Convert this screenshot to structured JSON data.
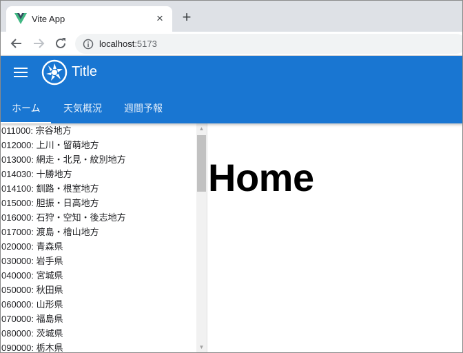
{
  "browser": {
    "tab_title": "Vite App",
    "tab_close": "×",
    "new_tab": "+",
    "url_host": "localhost",
    "url_port": ":5173"
  },
  "app": {
    "title": "Title",
    "accent_color": "#1976d2",
    "tabs": [
      {
        "label": "ホーム",
        "active": true
      },
      {
        "label": "天気概況",
        "active": false
      },
      {
        "label": "週間予報",
        "active": false
      }
    ]
  },
  "area_list": [
    "011000: 宗谷地方",
    "012000: 上川・留萌地方",
    "013000: 網走・北見・紋別地方",
    "014030: 十勝地方",
    "014100: 釧路・根室地方",
    "015000: 胆振・日高地方",
    "016000: 石狩・空知・後志地方",
    "017000: 渡島・檜山地方",
    "020000: 青森県",
    "030000: 岩手県",
    "040000: 宮城県",
    "050000: 秋田県",
    "060000: 山形県",
    "070000: 福島県",
    "080000: 茨城県",
    "090000: 栃木県"
  ],
  "scroll": {
    "up": "▲",
    "down": "▼"
  },
  "main": {
    "heading": "Home"
  }
}
